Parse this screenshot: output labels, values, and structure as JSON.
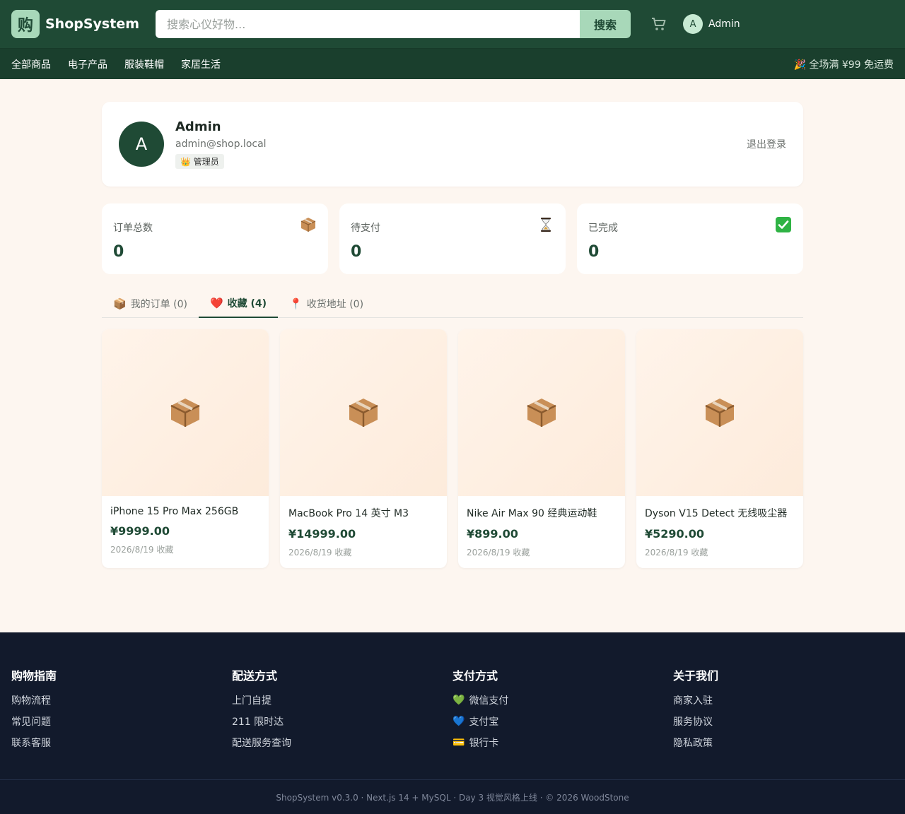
{
  "header": {
    "logo_char": "购",
    "brand": "ShopSystem",
    "search_placeholder": "搜索心仪好物...",
    "search_button": "搜索",
    "user_initial": "A",
    "user_name": "Admin"
  },
  "nav": {
    "items": [
      "全部商品",
      "电子产品",
      "服装鞋帽",
      "家居生活"
    ],
    "promo": "🎉 全场满 ¥99 免运费"
  },
  "profile": {
    "initial": "A",
    "name": "Admin",
    "email": "admin@shop.local",
    "role_badge": "👑 管理员",
    "logout": "退出登录"
  },
  "stats": [
    {
      "label": "订单总数",
      "value": "0",
      "icon": "package-icon"
    },
    {
      "label": "待支付",
      "value": "0",
      "icon": "hourglass-icon"
    },
    {
      "label": "已完成",
      "value": "0",
      "icon": "check-icon"
    }
  ],
  "tabs": [
    {
      "icon": "📦",
      "label": "我的订单 (0)",
      "active": false
    },
    {
      "icon": "❤️",
      "label": "收藏 (4)",
      "active": true
    },
    {
      "icon": "📍",
      "label": "收货地址 (0)",
      "active": false
    }
  ],
  "favorites": [
    {
      "name": "iPhone 15 Pro Max 256GB",
      "price": "¥9999.00",
      "date": "2026/8/19 收藏"
    },
    {
      "name": "MacBook Pro 14 英寸 M3",
      "price": "¥14999.00",
      "date": "2026/8/19 收藏"
    },
    {
      "name": "Nike Air Max 90 经典运动鞋",
      "price": "¥899.00",
      "date": "2026/8/19 收藏"
    },
    {
      "name": "Dyson V15 Detect 无线吸尘器",
      "price": "¥5290.00",
      "date": "2026/8/19 收藏"
    }
  ],
  "footer": {
    "columns": [
      {
        "title": "购物指南",
        "links": [
          {
            "text": "购物流程"
          },
          {
            "text": "常见问题"
          },
          {
            "text": "联系客服"
          }
        ]
      },
      {
        "title": "配送方式",
        "links": [
          {
            "text": "上门自提"
          },
          {
            "text": "211 限时达"
          },
          {
            "text": "配送服务查询"
          }
        ]
      },
      {
        "title": "支付方式",
        "links": [
          {
            "icon": "💚",
            "text": "微信支付"
          },
          {
            "icon": "💙",
            "text": "支付宝"
          },
          {
            "icon": "💳",
            "text": "银行卡"
          }
        ]
      },
      {
        "title": "关于我们",
        "links": [
          {
            "text": "商家入驻"
          },
          {
            "text": "服务协议"
          },
          {
            "text": "隐私政策"
          }
        ]
      }
    ],
    "copyright": "ShopSystem v0.3.0 · Next.js 14 + MySQL · Day 3 视觉风格上线 · © 2026 WoodStone"
  }
}
